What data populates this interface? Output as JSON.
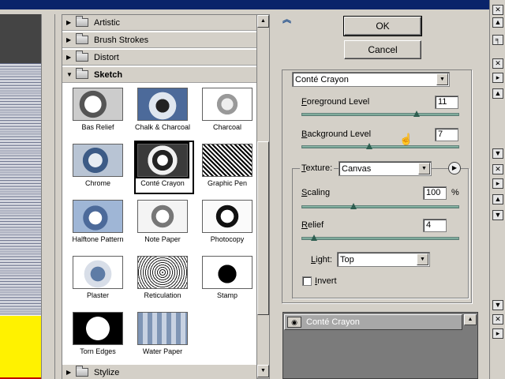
{
  "filter_gallery": {
    "categories": [
      {
        "label": "Artistic",
        "expanded": false
      },
      {
        "label": "Brush Strokes",
        "expanded": false
      },
      {
        "label": "Distort",
        "expanded": false
      },
      {
        "label": "Sketch",
        "expanded": true
      },
      {
        "label": "Stylize",
        "expanded": false
      }
    ],
    "sketch_filters": [
      {
        "label": "Bas Relief",
        "selected": false
      },
      {
        "label": "Chalk & Charcoal",
        "selected": false
      },
      {
        "label": "Charcoal",
        "selected": false
      },
      {
        "label": "Chrome",
        "selected": false
      },
      {
        "label": "Conté Crayon",
        "selected": true
      },
      {
        "label": "Graphic Pen",
        "selected": false
      },
      {
        "label": "Halftone Pattern",
        "selected": false
      },
      {
        "label": "Note Paper",
        "selected": false
      },
      {
        "label": "Photocopy",
        "selected": false
      },
      {
        "label": "Plaster",
        "selected": false
      },
      {
        "label": "Reticulation",
        "selected": false
      },
      {
        "label": "Stamp",
        "selected": false
      },
      {
        "label": "Torn Edges",
        "selected": false
      },
      {
        "label": "Water Paper",
        "selected": false
      }
    ]
  },
  "buttons": {
    "ok": "OK",
    "cancel": "Cancel",
    "collapse_icon": "chevron-double-up-icon"
  },
  "settings": {
    "filter_select": "Conté Crayon",
    "foreground_level": {
      "label_prefix": "",
      "label_ul": "F",
      "label_rest": "oreground Level",
      "value": "11",
      "fraction": 0.73
    },
    "background_level": {
      "label_ul": "B",
      "label_rest": "ackground Level",
      "value": "7",
      "fraction": 0.43
    },
    "texture": {
      "label_ul": "T",
      "label_rest": "exture:",
      "value": "Canvas"
    },
    "scaling": {
      "label_ul": "S",
      "label_rest": "caling",
      "value": "100",
      "unit": "%",
      "fraction": 0.33
    },
    "relief": {
      "label_ul": "R",
      "label_rest": "elief",
      "value": "4",
      "fraction": 0.08
    },
    "light": {
      "label_ul": "L",
      "label_rest": "ight:",
      "value": "Top"
    },
    "invert": {
      "label_ul": "I",
      "label_rest": "nvert",
      "checked": false
    }
  },
  "layers": {
    "effect_name": "Conté Crayon",
    "eye_icon": "eye-icon"
  },
  "colors": {
    "title_bar": "#0a246a",
    "dialog_bg": "#d4d0c8",
    "slider": "#5f8f80"
  }
}
